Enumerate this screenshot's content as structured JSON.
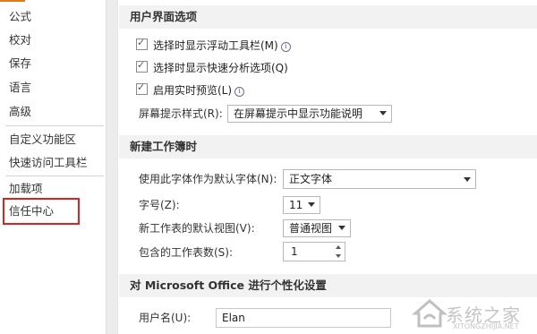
{
  "sidebar": {
    "items": [
      {
        "label": "公式"
      },
      {
        "label": "校对"
      },
      {
        "label": "保存"
      },
      {
        "label": "语言"
      },
      {
        "label": "高级"
      },
      {
        "label": "自定义功能区"
      },
      {
        "label": "快速访问工具栏"
      },
      {
        "label": "加载项"
      },
      {
        "label": "信任中心"
      }
    ],
    "highlight_color": "#e0211d"
  },
  "ui_options": {
    "title": "用户界面选项",
    "mini_toolbar": {
      "label": "选择时显示浮动工具栏(M)",
      "checked": true
    },
    "quick_analysis": {
      "label": "选择时显示快速分析选项(Q)",
      "checked": true
    },
    "live_preview": {
      "label": "启用实时预览(L)",
      "checked": true
    },
    "screentip": {
      "label": "屏幕提示样式(R):",
      "value": "在屏幕提示中显示功能说明"
    }
  },
  "new_workbook": {
    "title": "新建工作簿时",
    "font": {
      "label": "使用此字体作为默认字体(N):",
      "value": "正文字体"
    },
    "size": {
      "label": "字号(Z):",
      "value": "11"
    },
    "view": {
      "label": "新工作表的默认视图(V):",
      "value": "普通视图"
    },
    "sheets": {
      "label": "包含的工作表数(S):",
      "value": "1"
    }
  },
  "personalize": {
    "title": "对 Microsoft Office 进行个性化设置",
    "username": {
      "label": "用户名(U):",
      "value": "Elan"
    }
  },
  "watermark": {
    "text": "系统之家",
    "url": "XITONGZHIJIA.NET"
  },
  "colors": {
    "accent": "#e07a1f",
    "header_bg": "#f2f2f2"
  }
}
